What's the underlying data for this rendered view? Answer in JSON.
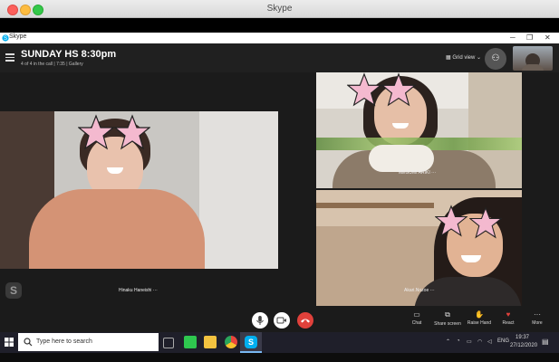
{
  "mac": {
    "title": "Skype"
  },
  "window": {
    "app_name": "Skype",
    "minimize": "─",
    "restore": "❐",
    "close": "✕"
  },
  "header": {
    "call_title": "SUNDAY HS 8:30pm",
    "subtitle": "4 of 4 in the call | 7:35 | Gallery",
    "grid_view_label": "Grid view"
  },
  "participants": [
    {
      "name": "Hinaku Haneishi ···"
    },
    {
      "name": "MEGUMI ARIKI ···"
    },
    {
      "name": "Akari.Nozoe ···"
    }
  ],
  "actions": [
    {
      "label": "Chat",
      "icon": "chat-icon"
    },
    {
      "label": "Share screen",
      "icon": "share-screen-icon"
    },
    {
      "label": "Raise Hand",
      "icon": "raise-hand-icon"
    },
    {
      "label": "React",
      "icon": "heart-icon"
    },
    {
      "label": "More",
      "icon": "more-icon"
    }
  ],
  "taskbar": {
    "search_placeholder": "Type here to search",
    "lang": "ENG",
    "time": "19:37",
    "date": "27/12/2020"
  },
  "colors": {
    "accent": "#00aff0",
    "hangup": "#e0413b",
    "react_heart": "#e0413b",
    "star_fill": "#f4b9cf"
  }
}
